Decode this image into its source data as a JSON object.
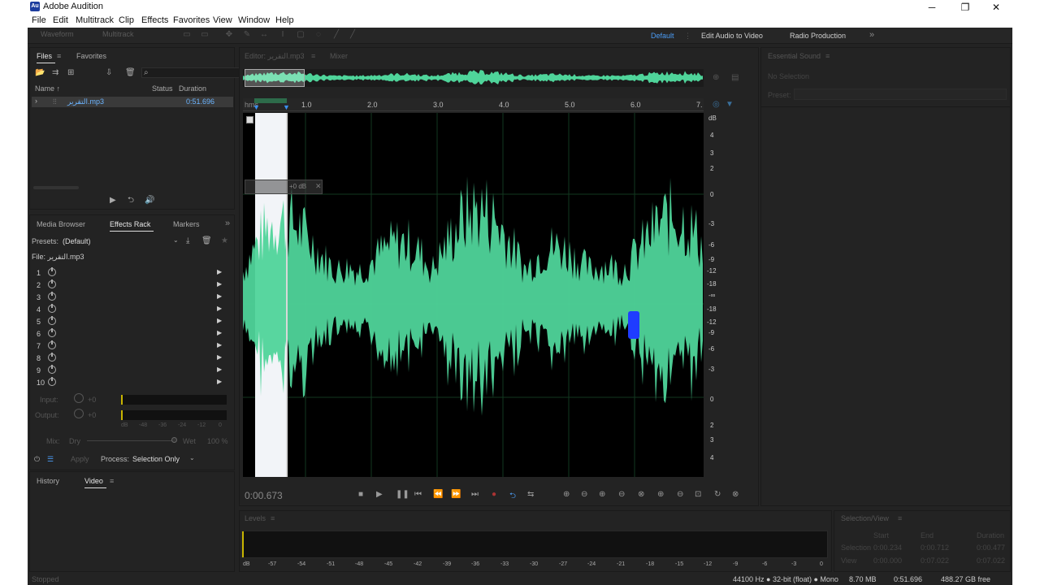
{
  "app": {
    "title": "Adobe Audition",
    "logo": "Au"
  },
  "window_controls": {
    "minimize": "─",
    "maximize": "❐",
    "close": "✕"
  },
  "menu": [
    "File",
    "Edit",
    "Multitrack",
    "Clip",
    "Effects",
    "Favorites",
    "View",
    "Window",
    "Help"
  ],
  "toolbar": {
    "waveform_label": "Waveform",
    "multitrack_label": "Multitrack",
    "workspaces": [
      "Default",
      "Edit Audio to Video",
      "Radio Production"
    ],
    "active_workspace": "Default",
    "more": "»"
  },
  "files_panel": {
    "tabs": [
      "Files",
      "Favorites"
    ],
    "col_name": "Name",
    "col_status": "Status",
    "col_duration": "Duration",
    "file": {
      "name": "التقرير.mp3",
      "duration": "0:51.696"
    }
  },
  "effects_panel": {
    "tabs": [
      "Media Browser",
      "Effects Rack",
      "Markers"
    ],
    "presets_label": "Presets:",
    "presets_value": "(Default)",
    "file_label": "File: التقرير.mp3",
    "slots": [
      "1",
      "2",
      "3",
      "4",
      "5",
      "6",
      "7",
      "8",
      "9",
      "10"
    ],
    "input_label": "Input:",
    "output_label": "Output:",
    "gain_value": "+0",
    "meter_ticks": [
      "dB",
      "-48",
      "-36",
      "-24",
      "-12",
      "0"
    ],
    "mix_label": "Mix:",
    "dry_label": "Dry",
    "wet_label": "Wet",
    "wet_value": "100 %",
    "apply_label": "Apply",
    "process_label": "Process:",
    "process_value": "Selection Only"
  },
  "bottom_left_tabs": [
    "History",
    "Video"
  ],
  "editor": {
    "tab_label": "Editor: التقرير.mp3",
    "mixer_label": "Mixer",
    "ruler_unit": "hms",
    "ruler_ticks": [
      "1.0",
      "2.0",
      "3.0",
      "4.0",
      "5.0",
      "6.0",
      "7."
    ],
    "db_unit": "dB",
    "db_labels": [
      "4",
      "3",
      "2",
      "0",
      "-3",
      "-6",
      "-9",
      "-12",
      "-18",
      "-∞",
      "-18",
      "-12",
      "-9",
      "-6",
      "-3",
      "0",
      "2",
      "3",
      "4"
    ],
    "hud_value": "+0 dB",
    "current_time": "0:00.673",
    "waveform_color": "#4fd49a"
  },
  "essential_sound": {
    "title": "Essential Sound",
    "no_selection": "No Selection",
    "preset_label": "Preset:"
  },
  "levels": {
    "title": "Levels",
    "ticks": [
      "dB",
      "-57",
      "-54",
      "-51",
      "-48",
      "-45",
      "-42",
      "-39",
      "-36",
      "-33",
      "-30",
      "-27",
      "-24",
      "-21",
      "-18",
      "-15",
      "-12",
      "-9",
      "-6",
      "-3",
      "0"
    ]
  },
  "selection_view": {
    "title": "Selection/View",
    "headers": [
      "Start",
      "End",
      "Duration"
    ],
    "rows": [
      {
        "label": "Selection",
        "start": "0:00.234",
        "end": "0:00.712",
        "duration": "0:00.477"
      },
      {
        "label": "View",
        "start": "0:00.000",
        "end": "0:07.022",
        "duration": "0:07.022"
      }
    ]
  },
  "status_bar": {
    "state": "Stopped",
    "format": "44100 Hz ● 32-bit (float) ● Mono",
    "size": "8.70 MB",
    "duration": "0:51.696",
    "free": "488.27 GB free"
  }
}
